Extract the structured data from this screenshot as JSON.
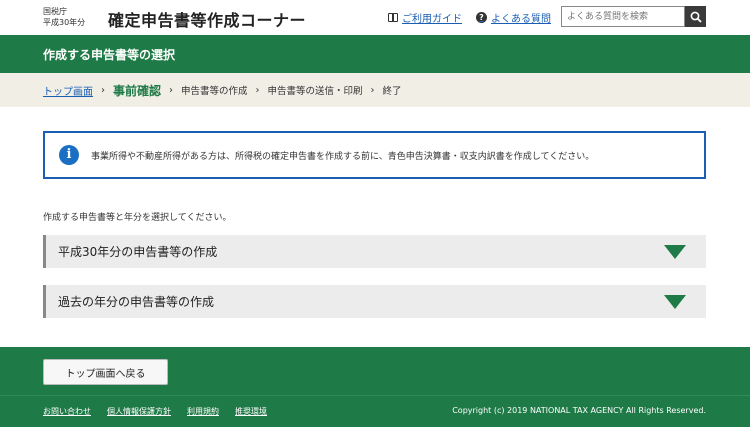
{
  "header": {
    "agency": "国税庁",
    "year": "平成30年分",
    "site_title": "確定申告書等作成コーナー",
    "guide_link": "ご利用ガイド",
    "faq_link": "よくある質問",
    "search_placeholder": "よくある質問を検索"
  },
  "band": {
    "title": "作成する申告書等の選択"
  },
  "breadcrumb": {
    "items": [
      "トップ画面",
      "事前確認",
      "申告書等の作成",
      "申告書等の送信・印刷",
      "終了"
    ]
  },
  "info": {
    "icon": "i",
    "text": "事業所得や不動産所得がある方は、所得税の確定申告書を作成する前に、青色申告決算書・収支内訳書を作成してください。"
  },
  "prompt": "作成する申告書等と年分を選択してください。",
  "accordions": [
    {
      "label": "平成30年分の申告書等の作成"
    },
    {
      "label": "過去の年分の申告書等の作成"
    }
  ],
  "footer": {
    "back_button": "トップ画面へ戻る",
    "links": [
      "お問い合わせ",
      "個人情報保護方針",
      "利用規約",
      "推奨環境"
    ],
    "copyright": "Copyright (c) 2019 NATIONAL TAX AGENCY All Rights Reserved."
  },
  "colors": {
    "brand_green": "#1e7a46",
    "link_blue": "#1a5fb4",
    "crumb_bg": "#f1eee6"
  }
}
